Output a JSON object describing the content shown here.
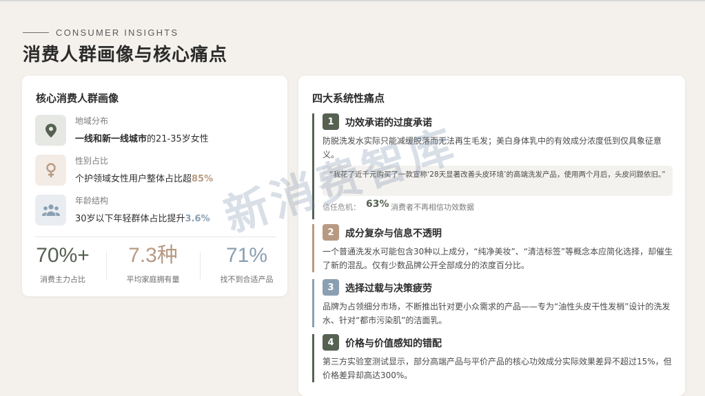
{
  "header": {
    "eyebrow": "CONSUMER INSIGHTS",
    "title": "消费人群画像与核心痛点"
  },
  "left_card": {
    "title": "核心消费人群画像",
    "attributes": [
      {
        "icon": "map-pin-icon",
        "label": "地域分布",
        "value_bold": "一线和新一线城市",
        "value_rest": "的21-35岁女性"
      },
      {
        "icon": "female-icon",
        "label": "性别占比",
        "value_rest": "个护领域女性用户整体占比超",
        "value_accent": "85%"
      },
      {
        "icon": "users-icon",
        "label": "年龄结构",
        "value_rest": "30岁以下年轻群体占比提升",
        "value_accent": "3.6%"
      }
    ],
    "stats": [
      {
        "value": "70%+",
        "label": "消费主力占比",
        "color": "#566152"
      },
      {
        "value": "7.3种",
        "label": "平均家庭拥有量",
        "color": "#b89a82"
      },
      {
        "value": "71%",
        "label": "找不到合适产品",
        "color": "#8b9fb2"
      }
    ]
  },
  "right_card": {
    "title": "四大系统性痛点",
    "pains": [
      {
        "num": "1",
        "title": "功效承诺的过度承诺",
        "desc": "防脱洗发水实际只能减缓脱落而无法再生毛发；美白身体乳中的有效成分浓度低到仅具象征意义。",
        "quote": "“我花了近千元购买了一款宣称‘28天显著改善头皮环境’的高端洗发产品，使用两个月后，头皮问题依旧。”",
        "trust_label": "信任危机：",
        "trust_value": "63%",
        "trust_note": "消费者不再相信功效数据",
        "color": "#566152"
      },
      {
        "num": "2",
        "title": "成分复杂与信息不透明",
        "desc": "一个普通洗发水可能包含30种以上成分，“纯净美妆”、“清洁标签”等概念本应简化选择，却催生了新的混乱。仅有少数品牌公开全部成分的浓度百分比。",
        "color": "#b89a82"
      },
      {
        "num": "3",
        "title": "选择过载与决策疲劳",
        "desc": "品牌为占领细分市场，不断推出针对更小众需求的产品——专为“油性头皮干性发梢”设计的洗发水、针对“都市污染肌”的洁面乳。",
        "color": "#8b9fb2"
      },
      {
        "num": "4",
        "title": "价格与价值感知的错配",
        "desc": "第三方实验室测试显示，部分高端产品与平价产品的核心功效成分实际效果差异不超过15%，但价格差异却高达300%。",
        "color": "#566152"
      }
    ]
  },
  "watermark": "新消费智库"
}
